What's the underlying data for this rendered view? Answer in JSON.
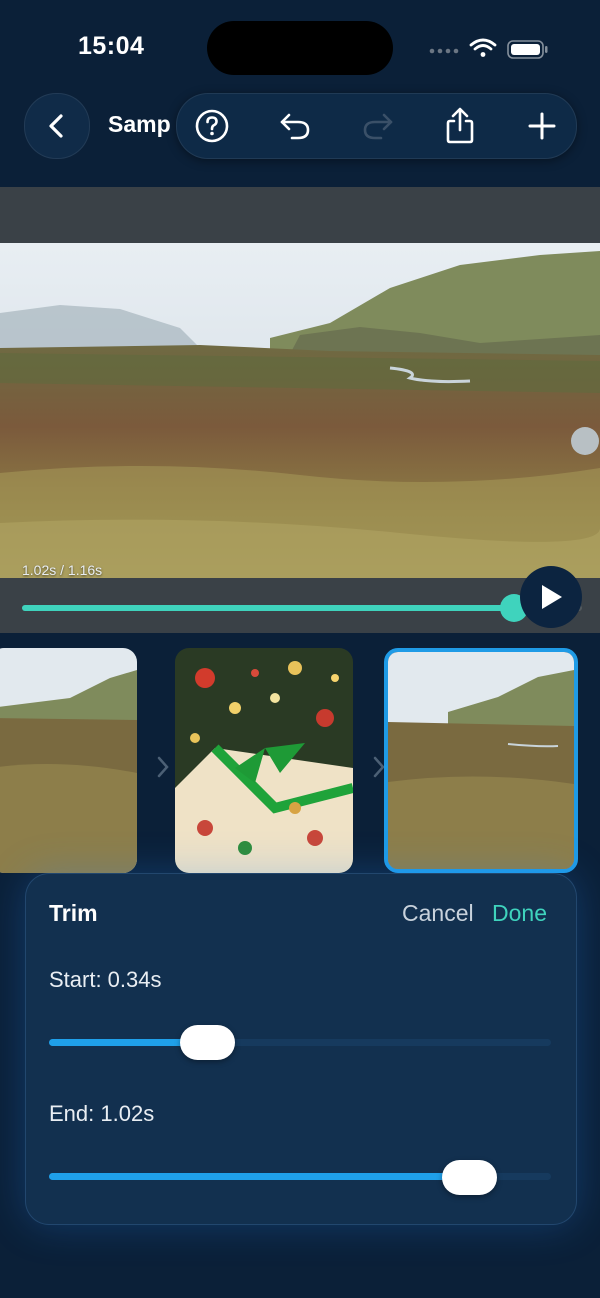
{
  "status_bar": {
    "time": "15:04"
  },
  "header": {
    "project_title": "Samp"
  },
  "preview": {
    "time_label": "1.02s / 1.16s",
    "playback_progress": 0.879
  },
  "trim": {
    "title": "Trim",
    "cancel_label": "Cancel",
    "done_label": "Done",
    "start_label": "Start: 0.34s",
    "end_label": "End: 1.02s",
    "start_value": 0.34,
    "end_value": 1.02,
    "duration": 1.16
  },
  "colors": {
    "accent_teal": "#3fd3bd",
    "accent_blue": "#1fa0ea",
    "background": "#0b2038"
  }
}
